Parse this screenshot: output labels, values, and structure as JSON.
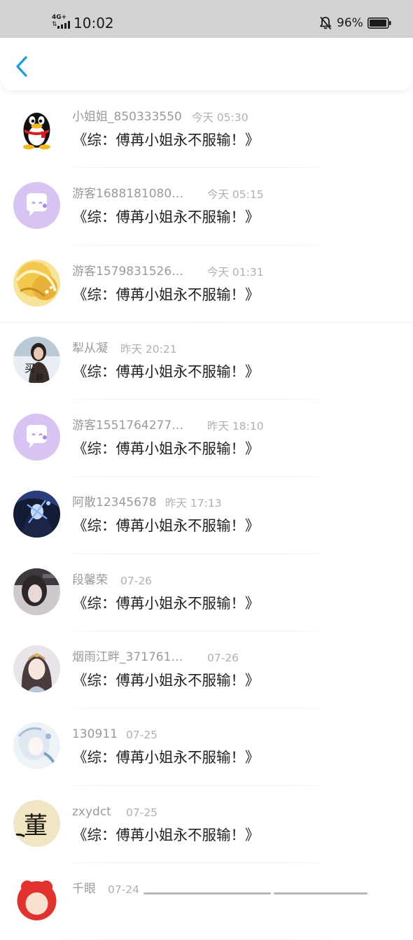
{
  "status_bar": {
    "network": "4G+",
    "time": "10:02",
    "battery": "96%",
    "battery_level": 0.96
  },
  "colors": {
    "accent": "#1e9bd9",
    "status_bar_bg": "#d3d3d3",
    "name_text": "#9a9a9a",
    "time_text": "#b0b0b0",
    "message_text": "#222222",
    "default_avatar": "#d7c4f3"
  },
  "header": {
    "back_icon": "chevron-left-icon"
  },
  "messages": [
    {
      "name": "小姐姐_850333550",
      "time": "今天 05:30",
      "text": "《综：傅苒小姐永不服输！》",
      "avatar": "qq-penguin"
    },
    {
      "name": "游客1688181080…",
      "time": "今天 05:15",
      "text": "《综：傅苒小姐永不服输！》",
      "avatar": "default-chat"
    },
    {
      "name": "游客1579831526…",
      "time": "今天 01:31",
      "text": "《综：傅苒小姐永不服输！》",
      "avatar": "golden-hair-photo"
    },
    {
      "name": "犁从凝",
      "time": "昨天 20:21",
      "text": "《综：傅苒小姐永不服输！》",
      "avatar": "girl-photo"
    },
    {
      "name": "游客1551764277…",
      "time": "昨天 18:10",
      "text": "《综：傅苒小姐永不服输！》",
      "avatar": "default-chat"
    },
    {
      "name": "阿散12345678",
      "time": "昨天 17:13",
      "text": "《综：傅苒小姐永不服输！》",
      "avatar": "anime-dark"
    },
    {
      "name": "段馨荣",
      "time": "07-26",
      "text": "《综：傅苒小姐永不服输！》",
      "avatar": "photo-dark"
    },
    {
      "name": "烟雨江畔_371761…",
      "time": "07-26",
      "text": "《综：傅苒小姐永不服输！》",
      "avatar": "anime-lady"
    },
    {
      "name": "130911",
      "time": "07-25",
      "text": "《综：傅苒小姐永不服输！》",
      "avatar": "anime-white"
    },
    {
      "name": "zxydct",
      "time": "07-25",
      "text": "《综：傅苒小姐永不服输！》",
      "avatar": "calligraphy"
    },
    {
      "name": "千眼",
      "time": "07-24",
      "text": "",
      "avatar": "red-cartoon"
    }
  ]
}
